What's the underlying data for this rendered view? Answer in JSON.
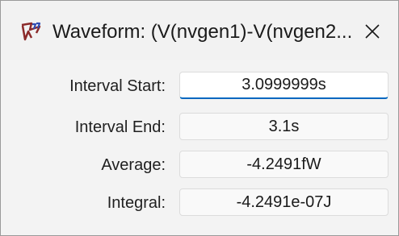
{
  "window": {
    "title": "Waveform: (V(nvgen1)-V(nvgen2...",
    "close_symbol": "✕"
  },
  "fields": [
    {
      "label": "Interval Start:",
      "value": "3.0999999s"
    },
    {
      "label": "Interval End:",
      "value": "3.1s"
    },
    {
      "label": "Average:",
      "value": "-4.2491fW"
    },
    {
      "label": "Integral:",
      "value": "-4.2491e-07J"
    }
  ],
  "icons": {
    "app": "ltspice-waveform-icon",
    "close": "close-icon"
  },
  "colors": {
    "focus_accent": "#0067c0",
    "icon_brown": "#8b2a2a",
    "icon_blue": "#2f4db3"
  }
}
